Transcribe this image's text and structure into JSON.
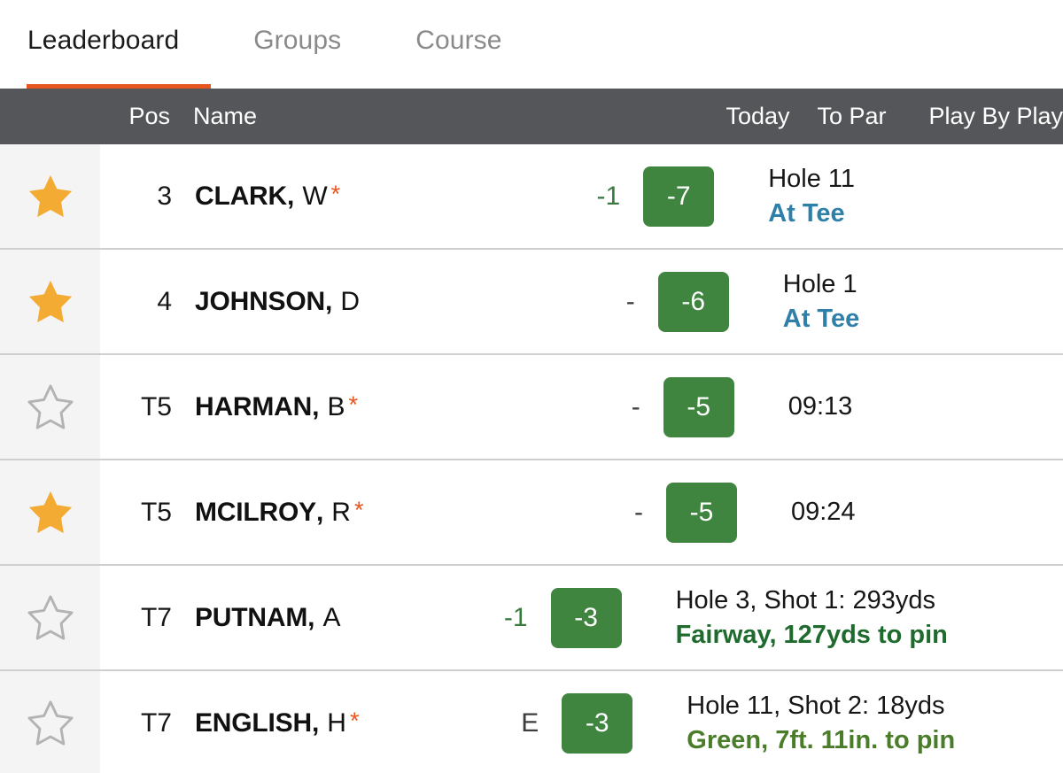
{
  "tabs": [
    {
      "label": "Leaderboard",
      "active": true
    },
    {
      "label": "Groups",
      "active": false
    },
    {
      "label": "Course",
      "active": false
    }
  ],
  "colors": {
    "accent_orange": "#e8561f",
    "header_gray": "#545659",
    "badge_green": "#40853f",
    "star_filled": "#f4ab33",
    "star_empty_stroke": "#b3b3b3",
    "today_under_par": "#3a7a3f",
    "at_tee_blue": "#2e80a8",
    "fairway_green": "#1f6b2e",
    "green_olive": "#4a7c2a"
  },
  "table": {
    "columns": {
      "star": "",
      "pos": "Pos",
      "name": "Name",
      "today": "Today",
      "to_par": "To Par",
      "play_by_play": "Play By Play"
    },
    "rows": [
      {
        "starred": true,
        "star_icon": "star-filled-icon",
        "pos": "3",
        "last_name": "CLARK",
        "separator": ",",
        "first_initial": "W",
        "amateur_mark": "*",
        "today": "-1",
        "today_state": "under",
        "to_par": "-7",
        "pbp_line1": "Hole 11",
        "pbp_line2": "At Tee",
        "pbp_line2_style": "attee"
      },
      {
        "starred": true,
        "star_icon": "star-filled-icon",
        "pos": "4",
        "last_name": "JOHNSON",
        "separator": ",",
        "first_initial": "D",
        "amateur_mark": "",
        "today": "-",
        "today_state": "none",
        "to_par": "-6",
        "pbp_line1": "Hole 1",
        "pbp_line2": "At Tee",
        "pbp_line2_style": "attee"
      },
      {
        "starred": false,
        "star_icon": "star-outline-icon",
        "pos": "T5",
        "last_name": "HARMAN",
        "separator": ",",
        "first_initial": "B",
        "amateur_mark": "*",
        "today": "-",
        "today_state": "none",
        "to_par": "-5",
        "pbp_line1": "09:13",
        "pbp_line2": "",
        "pbp_line2_style": ""
      },
      {
        "starred": true,
        "star_icon": "star-filled-icon",
        "pos": "T5",
        "last_name": "MCILROY",
        "separator": ",",
        "first_initial": "R",
        "amateur_mark": "*",
        "today": "-",
        "today_state": "none",
        "to_par": "-5",
        "pbp_line1": "09:24",
        "pbp_line2": "",
        "pbp_line2_style": ""
      },
      {
        "starred": false,
        "star_icon": "star-outline-icon",
        "pos": "T7",
        "last_name": "PUTNAM",
        "separator": ",",
        "first_initial": "A",
        "amateur_mark": "",
        "today": "-1",
        "today_state": "under",
        "to_par": "-3",
        "pbp_line1": "Hole 3, Shot 1: 293yds",
        "pbp_line2": "Fairway, 127yds to pin",
        "pbp_line2_style": "fairway"
      },
      {
        "starred": false,
        "star_icon": "star-outline-icon",
        "pos": "T7",
        "last_name": "ENGLISH",
        "separator": ",",
        "first_initial": "H",
        "amateur_mark": "*",
        "today": "E",
        "today_state": "even",
        "to_par": "-3",
        "pbp_line1": "Hole 11, Shot 2: 18yds",
        "pbp_line2": "Green, 7ft. 11in. to pin",
        "pbp_line2_style": "green"
      }
    ]
  }
}
